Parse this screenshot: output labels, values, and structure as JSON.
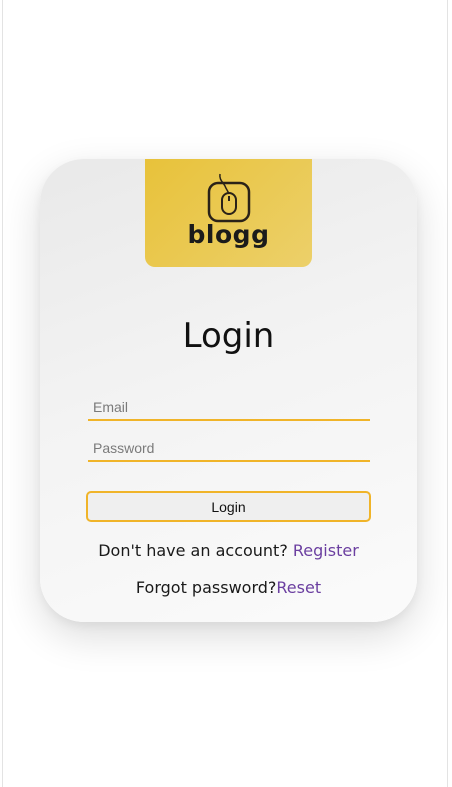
{
  "brand": {
    "logo_text": "blogg",
    "logo_icon": "mouse-icon",
    "accent_color": "#e8c23a"
  },
  "form": {
    "title": "Login",
    "email_placeholder": "Email",
    "password_placeholder": "Password",
    "login_button_label": "Login"
  },
  "footer": {
    "register_prompt": "Don't have an account?",
    "register_link": "Register",
    "forgot_prompt": "Forgot password?",
    "reset_link": "Reset",
    "link_color": "#6b3fa0",
    "input_underline_color": "#f0b429"
  }
}
